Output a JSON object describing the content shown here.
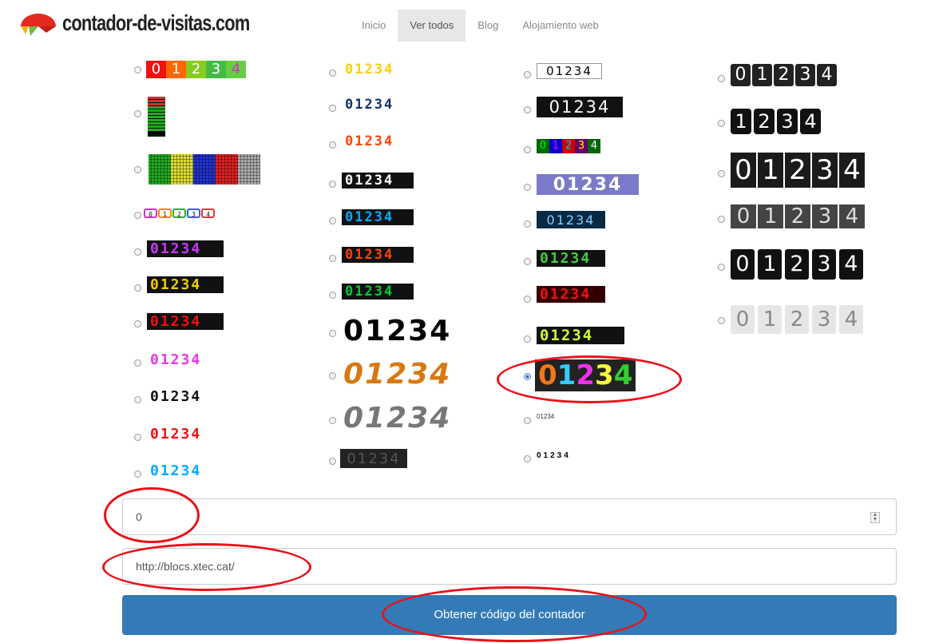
{
  "brand": {
    "name": "contador-de-visitas.com"
  },
  "nav": {
    "items": [
      "Inicio",
      "Ver todos",
      "Blog",
      "Alojamiento web"
    ],
    "active": "Ver todos"
  },
  "counter_sample": "01234",
  "form": {
    "start_value": "0",
    "url_value": "http://blocs.xtec.cat/",
    "submit_label": "Obtener código del contador"
  },
  "colors": {
    "accent": "#337ab7",
    "highlight": "#e8121a"
  }
}
